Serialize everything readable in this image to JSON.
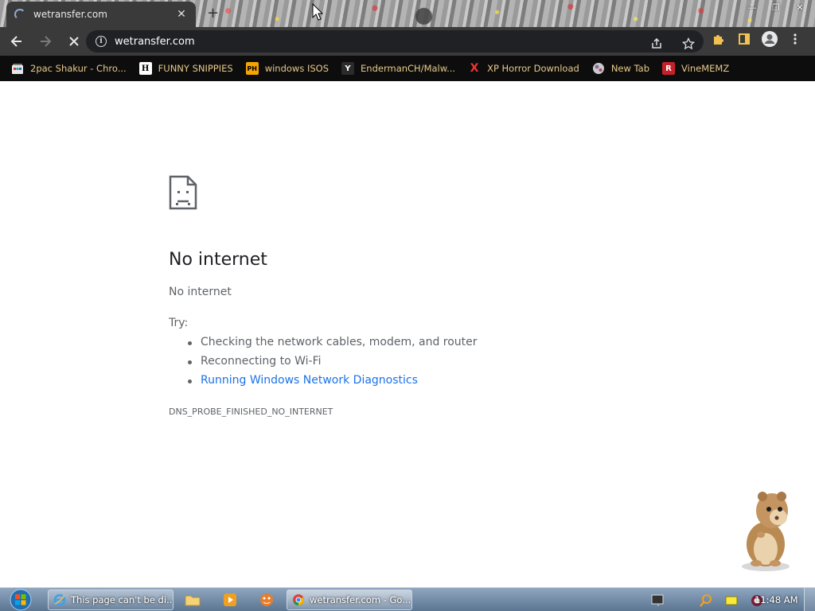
{
  "browser": {
    "tab_title": "wetransfer.com",
    "new_tab_symbol": "+",
    "tab_close_symbol": "✕",
    "url": "wetransfer.com",
    "window_controls": {
      "minimize": "—",
      "restore": "❐",
      "close": "✕"
    }
  },
  "bookmarks": [
    {
      "label": "2pac Shakur - Chro...",
      "icon": "chrome-web-store-icon"
    },
    {
      "label": "FUNNY SNIPPIES",
      "icon": "h-letter-icon",
      "icon_text": "H"
    },
    {
      "label": "windows ISOS",
      "icon": "ph-icon",
      "icon_text": "PH"
    },
    {
      "label": "EndermanCH/Malw...",
      "icon": "github-icon",
      "icon_text": "Y"
    },
    {
      "label": "XP Horror Download",
      "icon": "red-x-icon",
      "icon_text": "X"
    },
    {
      "label": "New Tab",
      "icon": "globe-icon"
    },
    {
      "label": "VineMEMZ",
      "icon": "r-icon",
      "icon_text": "R"
    }
  ],
  "error_page": {
    "title": "No internet",
    "subtitle": "No internet",
    "try_label": "Try:",
    "suggestions": [
      "Checking the network cables, modem, and router",
      "Reconnecting to Wi-Fi",
      "Running Windows Network Diagnostics"
    ],
    "error_code": "DNS_PROBE_FINISHED_NO_INTERNET",
    "link_color": "#1a73e8"
  },
  "taskbar": {
    "tasks": [
      {
        "label": "This page can't be di...",
        "icon": "internet-explorer-icon"
      },
      {
        "label": "wetransfer.com - Go...",
        "icon": "chrome-icon"
      }
    ],
    "pinned": [
      "file-explorer-icon",
      "media-player-icon",
      "bonzi-app-icon"
    ],
    "tray": [
      "network-icon",
      "search-icon",
      "notes-icon",
      "record-icon"
    ],
    "clock": "11:48 AM"
  },
  "colors": {
    "toolbar_bg": "#3a3a3a",
    "bookmark_text": "#e8c98a",
    "taskbar": "#6f88a6"
  }
}
